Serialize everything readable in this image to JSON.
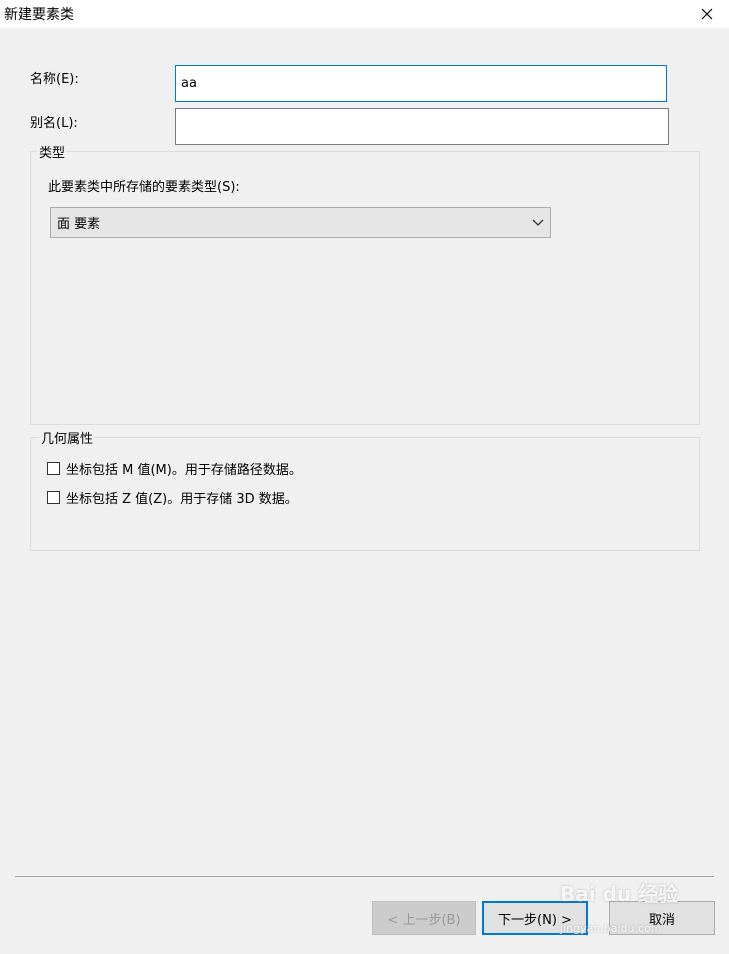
{
  "window": {
    "title": "新建要素类",
    "close_icon": "close-icon"
  },
  "form": {
    "name_label": "名称(E):",
    "name_value": "aa",
    "alias_label": "别名(L):",
    "alias_value": ""
  },
  "type_group": {
    "title": "类型",
    "description": "此要素类中所存储的要素类型(S):",
    "selected": "面 要素",
    "chevron_icon": "chevron-down-icon"
  },
  "geometry_group": {
    "title": "几何属性",
    "options": [
      {
        "label": "坐标包括 M 值(M)。用于存储路径数据。",
        "checked": false
      },
      {
        "label": "坐标包括 Z 值(Z)。用于存储 3D 数据。",
        "checked": false
      }
    ]
  },
  "buttons": {
    "back": "< 上一步(B)",
    "next": "下一步(N) >",
    "cancel": "取消"
  },
  "watermark": {
    "text": "Bai du 经验",
    "sub": "jingyan.baidu.com"
  }
}
